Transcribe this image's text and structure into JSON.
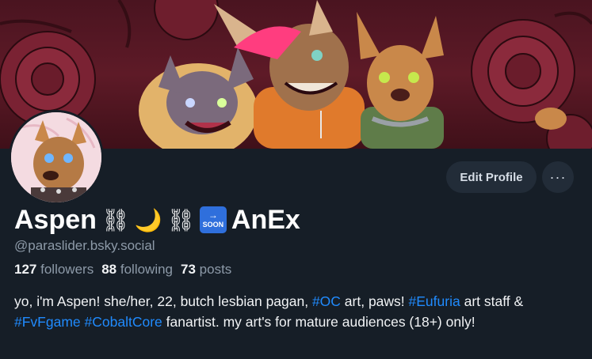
{
  "profile": {
    "display_name_main": "Aspen",
    "display_name_emojis": [
      "⛓",
      "🌙",
      "⛓"
    ],
    "soon_badge": "SOON",
    "display_name_suffix": "AnEx",
    "handle": "@paraslider.bsky.social",
    "stats": {
      "followers_count": "127",
      "followers_label": "followers",
      "following_count": "88",
      "following_label": "following",
      "posts_count": "73",
      "posts_label": "posts"
    },
    "bio": {
      "t1": "yo, i'm Aspen! she/her, 22, butch lesbian pagan, ",
      "tag1": "#OC",
      "t2": " art, paws! ",
      "tag2": "#Eufuria",
      "t3": " art staff & ",
      "tag3": "#FvFgame",
      "t4": " ",
      "tag4": "#CobaltCore",
      "t5": " fanartist. my art's for mature audiences (18+) only!"
    }
  },
  "actions": {
    "edit_profile_label": "Edit Profile",
    "more_label": "···"
  },
  "colors": {
    "background": "#161e27",
    "accent_link": "#208bfe",
    "muted_text": "#8d9aa8",
    "button_bg": "#222c38",
    "banner_base": "#5e1a27"
  }
}
